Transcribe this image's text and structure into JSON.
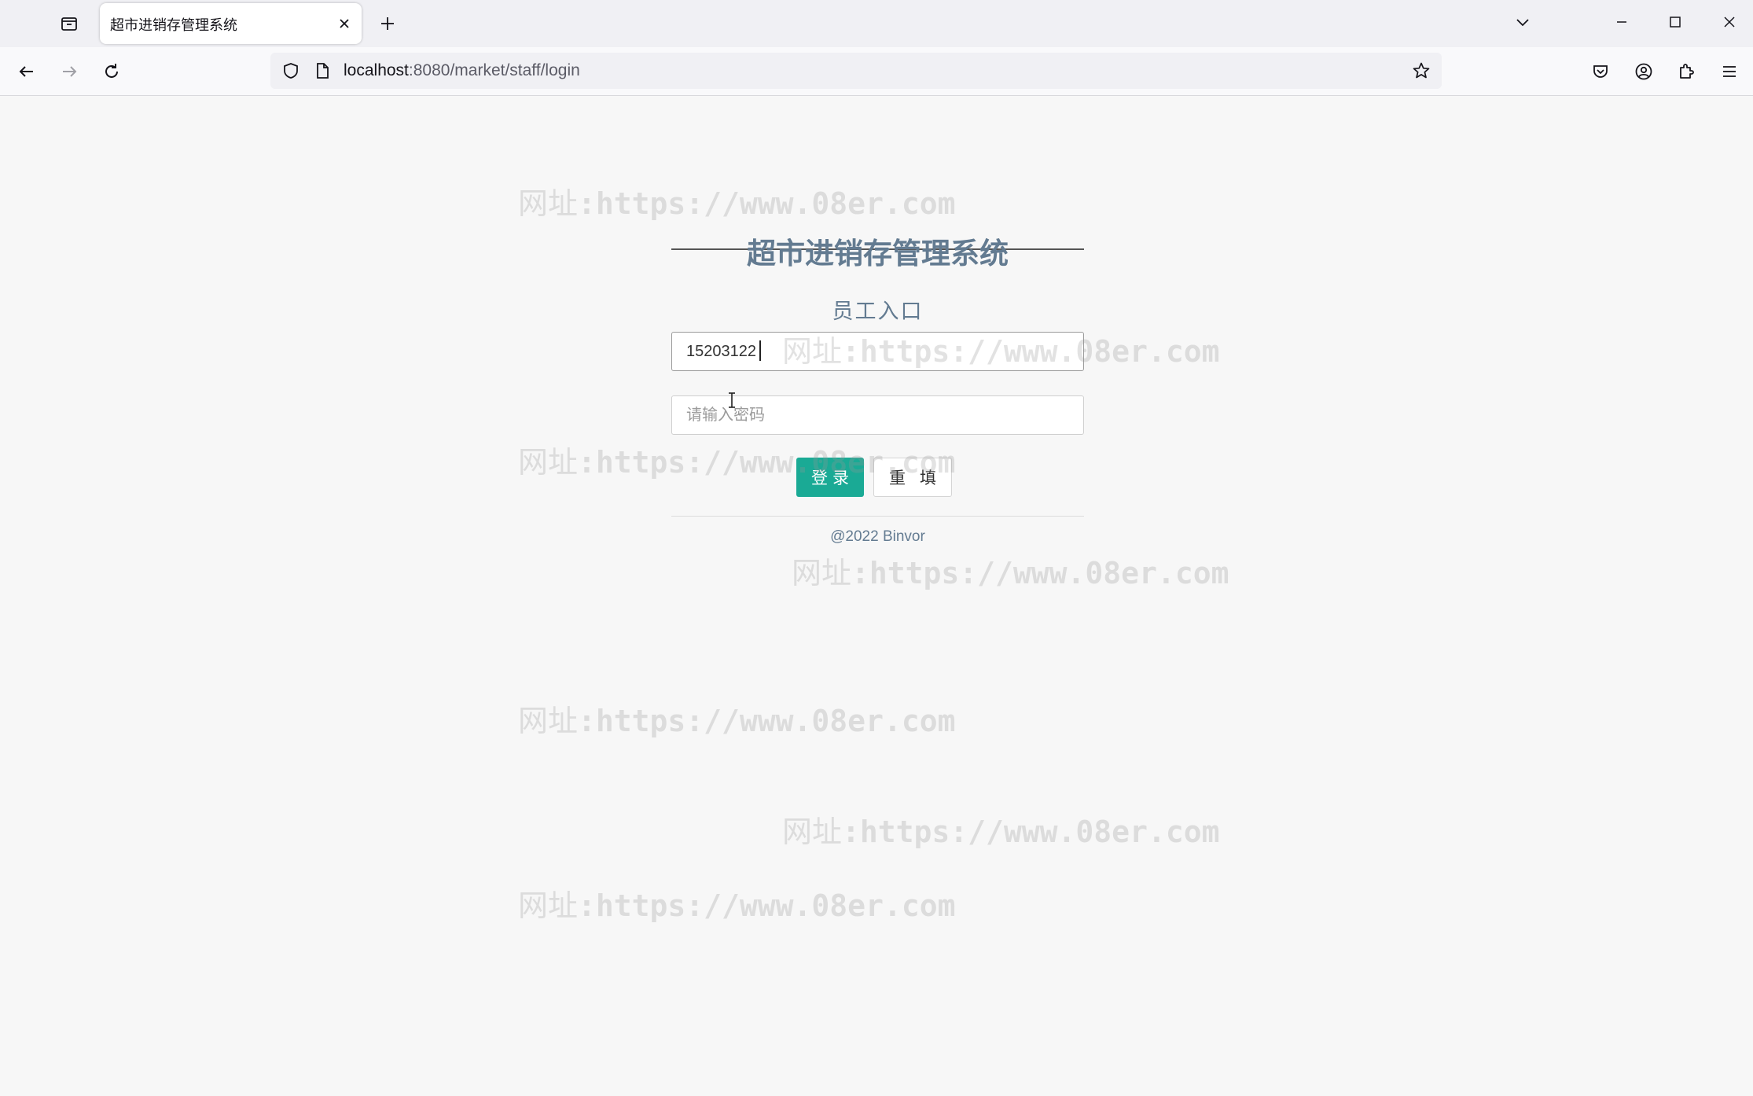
{
  "browser": {
    "tab_title": "超市进销存管理系统",
    "url_host": "localhost",
    "url_path": ":8080/market/staff/login"
  },
  "icons": {
    "tab_list": "tab-list-icon",
    "close": "close-icon",
    "new_tab": "plus-icon",
    "back": "back-arrow-icon",
    "forward": "forward-arrow-icon",
    "reload": "reload-icon",
    "shield": "shield-icon",
    "page": "page-icon",
    "star": "star-icon",
    "pocket": "pocket-icon",
    "account": "account-icon",
    "extensions": "puzzle-icon",
    "menu": "hamburger-menu-icon"
  },
  "login": {
    "title": "超市进销存管理系统",
    "subtitle": "员工入口",
    "username_value": "15203122",
    "password_placeholder": "请输入密码",
    "login_label": "登录",
    "reset_label": "重填",
    "footer": "@2022 Binvor"
  },
  "watermark": {
    "prefix": "网址",
    "text": ":https://www.08er.com"
  },
  "colors": {
    "accent": "#1aaa95",
    "title": "#637b91",
    "background": "#f7f7f7"
  }
}
